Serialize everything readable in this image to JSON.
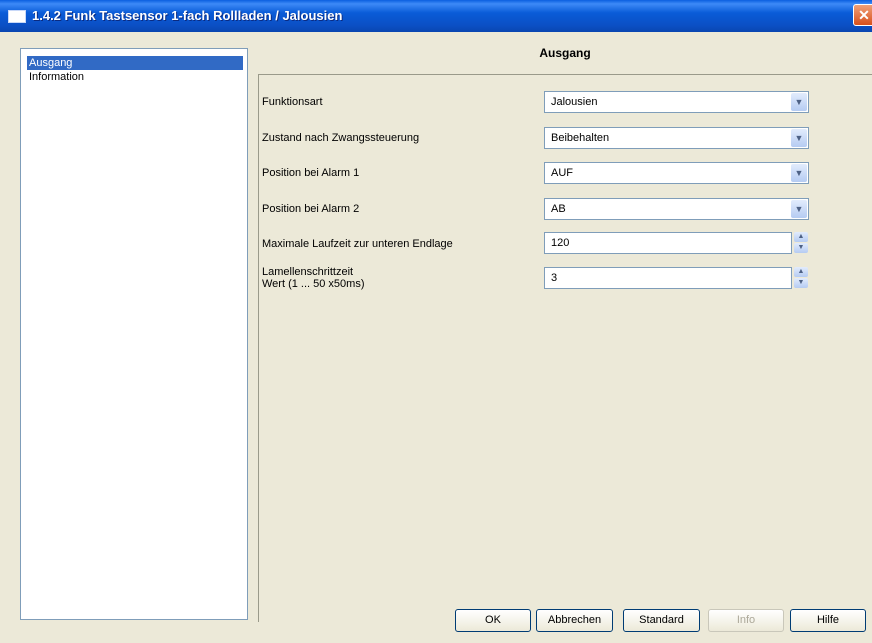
{
  "window": {
    "title": "1.4.2 Funk Tastsensor 1-fach Rollladen / Jalousien",
    "close_glyph": "✕"
  },
  "tree": {
    "items": [
      {
        "label": "Ausgang",
        "selected": true
      },
      {
        "label": "Information",
        "selected": false
      }
    ]
  },
  "panel": {
    "title": "Ausgang"
  },
  "params": {
    "funktionsart": {
      "label": "Funktionsart",
      "value": "Jalousien"
    },
    "zustand": {
      "label": "Zustand nach Zwangssteuerung",
      "value": "Beibehalten"
    },
    "alarm1": {
      "label": "Position bei Alarm 1",
      "value": "AUF"
    },
    "alarm2": {
      "label": "Position bei Alarm 2",
      "value": "AB"
    },
    "laufzeit": {
      "label": "Maximale Laufzeit zur unteren Endlage",
      "value": "120"
    },
    "lamellen": {
      "label_line1": "Lamellenschrittzeit",
      "label_line2": "Wert (1 ... 50 x50ms)",
      "value": "3"
    }
  },
  "buttons": {
    "ok": "OK",
    "cancel": "Abbrechen",
    "standard": "Standard",
    "info": "Info",
    "help": "Hilfe"
  },
  "icons": {
    "dropdown": "chevron-down-icon",
    "spin_up": "arrow-up-icon",
    "spin_down": "arrow-down-icon"
  }
}
